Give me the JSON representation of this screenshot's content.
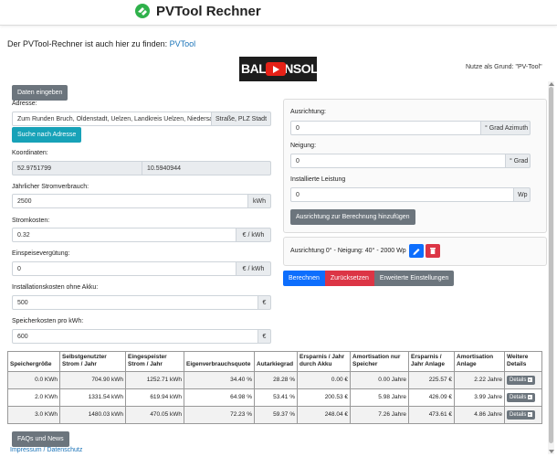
{
  "header": {
    "title": "PVTool Rechner"
  },
  "intro": {
    "text": "Der PVTool-Rechner ist auch hier zu finden: ",
    "link": "PVTool"
  },
  "video": {
    "thumbnail_text": "BALKONSOLAR",
    "note": "Nutze als Grund: \"PV-Tool\""
  },
  "left": {
    "data_button": "Daten eingeben",
    "address_label": "Adresse:",
    "address_value": "Zum Runden Bruch, Oldenstadt, Uelzen, Landkreis Uelzen, Niedersachsen",
    "address_addon": "Straße, PLZ Stadt",
    "search_button": "Suche nach Adresse",
    "coords_label": "Koordinaten:",
    "lat": "52.9751799",
    "lon": "10.5940944",
    "consumption_label": "Jährlicher Stromverbrauch:",
    "consumption_value": "2500",
    "consumption_unit": "kWh",
    "price_label": "Stromkosten:",
    "price_value": "0.32",
    "price_unit": "€ / kWh",
    "feedin_label": "Einspeisevergütung:",
    "feedin_value": "0",
    "feedin_unit": "€ / kWh",
    "install_label": "Installationskosten ohne Akku:",
    "install_value": "500",
    "install_unit": "€",
    "storage_cost_label": "Speicherkosten pro kWh:",
    "storage_cost_value": "600",
    "storage_cost_unit": "€"
  },
  "right": {
    "orientation_label": "Ausrichtung:",
    "orientation_value": "0",
    "orientation_unit": "° Grad Azimuth",
    "tilt_label": "Neigung:",
    "tilt_value": "0",
    "tilt_unit": "° Grad",
    "power_label": "Installierte Leistung",
    "power_value": "0",
    "power_unit": "Wp",
    "add_button": "Ausrichtung zur Berechnung hinzufügen",
    "entry_text": "Ausrichtung 0° - Neigung: 40° - 2000 Wp",
    "calc_button": "Berechnen",
    "reset_button": "Zurücksetzen",
    "advanced_button": "Erweiterte Einstellungen"
  },
  "table": {
    "headers": [
      "Speichergröße",
      "Selbstgenutzter Strom / Jahr",
      "Eingespeister Strom / Jahr",
      "Eigenverbrauchsquote",
      "Autarkiegrad",
      "Ersparnis / Jahr durch Akku",
      "Amortisation nur Speicher",
      "Ersparnis / Jahr Anlage",
      "Amortisation Anlage",
      "Weitere Details"
    ],
    "rows": [
      [
        "0.0 KWh",
        "704.90 kWh",
        "1252.71 kWh",
        "34.40 %",
        "28.28 %",
        "0.00 €",
        "0.00 Jahre",
        "225.57 €",
        "2.22 Jahre",
        "Details"
      ],
      [
        "2.0 KWh",
        "1331.54 kWh",
        "619.94 kWh",
        "64.98 %",
        "53.41 %",
        "200.53 €",
        "5.98 Jahre",
        "426.09 €",
        "3.99 Jahre",
        "Details"
      ],
      [
        "3.0 KWh",
        "1480.03 kWh",
        "470.05 kWh",
        "72.23 %",
        "59.37 %",
        "248.04 €",
        "7.26 Jahre",
        "473.61 €",
        "4.86 Jahre",
        "Details"
      ]
    ]
  },
  "footer": {
    "faq_button": "FAQs und News",
    "links": "Impressum / Datenschutz"
  },
  "colors": {
    "accent": "#0d6efd",
    "danger": "#dc3545",
    "secondary": "#6c757d",
    "info": "#17a2b8",
    "logo_green": "#28a745"
  }
}
